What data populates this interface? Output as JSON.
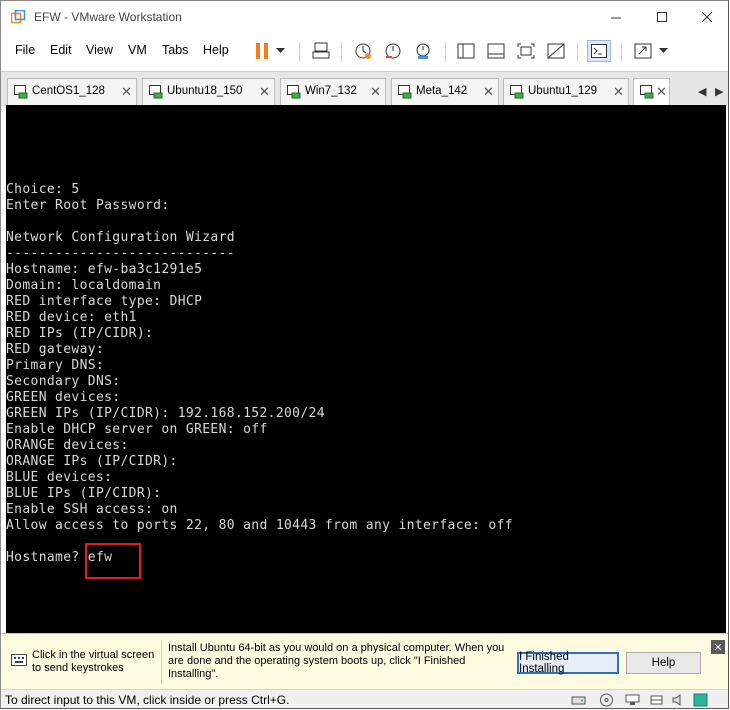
{
  "window": {
    "title": "EFW - VMware Workstation"
  },
  "menu": {
    "items": [
      "File",
      "Edit",
      "View",
      "VM",
      "Tabs",
      "Help"
    ]
  },
  "tabs": [
    {
      "label": "CentOS1_128",
      "active": false
    },
    {
      "label": "Ubuntu18_150",
      "active": false
    },
    {
      "label": "Win7_132",
      "active": false
    },
    {
      "label": "Meta_142",
      "active": false
    },
    {
      "label": "Ubuntu1_129",
      "active": false
    },
    {
      "label": "",
      "active": true
    }
  ],
  "console": {
    "lines": [
      "Choice: 5",
      "Enter Root Password:",
      "",
      "Network Configuration Wizard",
      "----------------------------",
      "Hostname: efw-ba3c1291e5",
      "Domain: localdomain",
      "RED interface type: DHCP",
      "RED device: eth1",
      "RED IPs (IP/CIDR):",
      "RED gateway:",
      "Primary DNS:",
      "Secondary DNS:",
      "GREEN devices:",
      "GREEN IPs (IP/CIDR): 192.168.152.200/24",
      "Enable DHCP server on GREEN: off",
      "ORANGE devices:",
      "ORANGE IPs (IP/CIDR):",
      "BLUE devices:",
      "BLUE IPs (IP/CIDR):",
      "Enable SSH access: on",
      "Allow access to ports 22, 80 and 10443 from any interface: off",
      "",
      "Hostname? efw"
    ],
    "prompt": "Hostname? efw",
    "input_value": "efw"
  },
  "infobar": {
    "hint": "Click in the virtual screen to send keystrokes",
    "message": "Install Ubuntu 64-bit as you would on a physical computer. When you are done and the operating system boots up, click \"I Finished Installing\".",
    "finished_button": "I Finished Installing",
    "help_button": "Help"
  },
  "statusbar": {
    "text": "To direct input to this VM, click inside or press Ctrl+G."
  },
  "colors": {
    "console_bg": "#000000",
    "console_text": "#d8d8d8",
    "highlight": "#e01e1e",
    "pause_icon": "#f57c1f",
    "infobar_bg": "#fffbe0"
  }
}
